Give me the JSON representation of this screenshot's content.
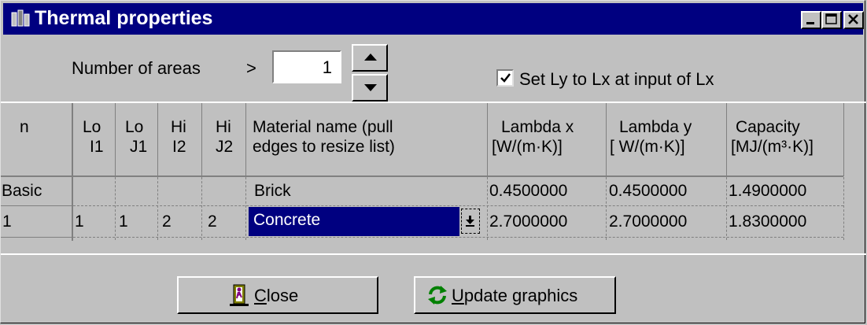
{
  "window": {
    "title": "Thermal properties",
    "controls": [
      "minimize-icon",
      "maximize-icon",
      "close-icon"
    ]
  },
  "top": {
    "number_of_areas_label": "Number of areas",
    "arrow": ">",
    "number_of_areas_value": "1",
    "set_ly_checked": true,
    "set_ly_label": "Set Ly to Lx at input of Lx"
  },
  "table": {
    "headers": {
      "n": "n",
      "lo_i1": [
        "Lo",
        "I1"
      ],
      "lo_j1": [
        "Lo",
        "J1"
      ],
      "hi_i2": [
        "Hi",
        "I2"
      ],
      "hi_j2": [
        "Hi",
        "J2"
      ],
      "material": [
        "Material name (pull",
        "edges to resize list)"
      ],
      "lambda_x": [
        "Lambda x",
        "[W/(m·K)]"
      ],
      "lambda_y": [
        "Lambda y",
        "[ W/(m·K)]"
      ],
      "capacity": [
        "Capacity",
        "[MJ/(m³·K)]"
      ]
    },
    "rows": [
      {
        "n": "Basic",
        "lo_i1": "",
        "lo_j1": "",
        "hi_i2": "",
        "hi_j2": "",
        "material": "Brick",
        "lambda_x": "0.4500000",
        "lambda_y": "0.4500000",
        "capacity": "1.4900000"
      },
      {
        "n": "1",
        "lo_i1": "1",
        "lo_j1": "1",
        "hi_i2": "2",
        "hi_j2": "2",
        "material": "Concrete",
        "lambda_x": "2.7000000",
        "lambda_y": "2.7000000",
        "capacity": "1.8300000"
      }
    ],
    "selected_cell": "rows.1.material"
  },
  "buttons": {
    "close_mnemonic": "C",
    "close_rest": "lose",
    "update_mnemonic": "U",
    "update_rest": "pdate graphics"
  },
  "colors": {
    "titlebar": "#000080",
    "face": "#c0c0c0",
    "selection": "#000080"
  }
}
